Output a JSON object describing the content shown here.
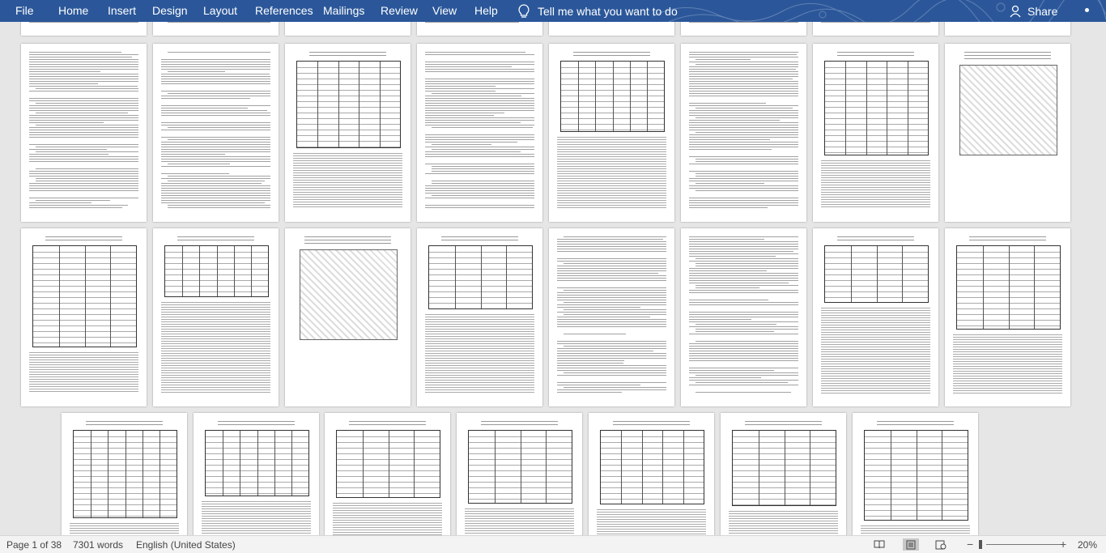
{
  "ribbon": {
    "file": "File",
    "tabs": [
      "Home",
      "Insert",
      "Design",
      "Layout",
      "References",
      "Mailings",
      "Review",
      "View",
      "Help"
    ],
    "tell_me": "Tell me what you want to do",
    "share": "Share",
    "background_color": "#2b579a"
  },
  "status": {
    "page": "Page 1 of 38",
    "words": "7301 words",
    "language": "English (United States)",
    "zoom_minus": "−",
    "zoom_plus": "+",
    "zoom_percent": "20%"
  },
  "views": [
    "read-mode-icon",
    "print-layout-icon",
    "web-layout-icon"
  ]
}
